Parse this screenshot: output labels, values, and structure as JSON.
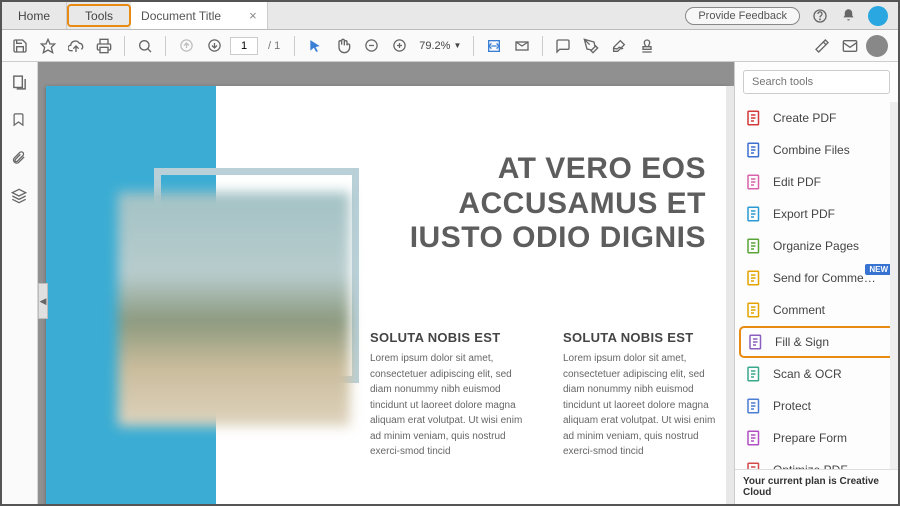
{
  "tabs": {
    "home": "Home",
    "tools": "Tools",
    "doc": "Document Title"
  },
  "header": {
    "feedback": "Provide Feedback"
  },
  "toolbar": {
    "page_current": "1",
    "page_total": "/  1",
    "zoom": "79.2%"
  },
  "document": {
    "headline": "AT VERO EOS ACCUSAMUS ET IUSTO ODIO DIGNIS",
    "col_heading": "SOLUTA NOBIS EST",
    "col_body": "Lorem ipsum dolor sit amet, consectetuer adipiscing elit, sed diam nonummy nibh euismod tincidunt ut laoreet dolore magna aliquam erat volutpat. Ut wisi enim ad minim veniam, quis nostrud exerci-smod tincid"
  },
  "panel": {
    "search_placeholder": "Search tools",
    "items": [
      {
        "label": "Create PDF",
        "color": "#d23a3a"
      },
      {
        "label": "Combine Files",
        "color": "#3d6fd1"
      },
      {
        "label": "Edit PDF",
        "color": "#d862a9"
      },
      {
        "label": "Export PDF",
        "color": "#2a9ad4"
      },
      {
        "label": "Organize Pages",
        "color": "#5aa338"
      },
      {
        "label": "Send for Comme…",
        "color": "#e4a400",
        "badge": "NEW"
      },
      {
        "label": "Comment",
        "color": "#e4a400"
      },
      {
        "label": "Fill & Sign",
        "color": "#8b5fbf",
        "highlight": true
      },
      {
        "label": "Scan & OCR",
        "color": "#3aa88b"
      },
      {
        "label": "Protect",
        "color": "#4a7dd4"
      },
      {
        "label": "Prepare Form",
        "color": "#b14fc2"
      },
      {
        "label": "Optimize PDF",
        "color": "#d24a4a"
      }
    ],
    "plan": "Your current plan is Creative Cloud"
  }
}
